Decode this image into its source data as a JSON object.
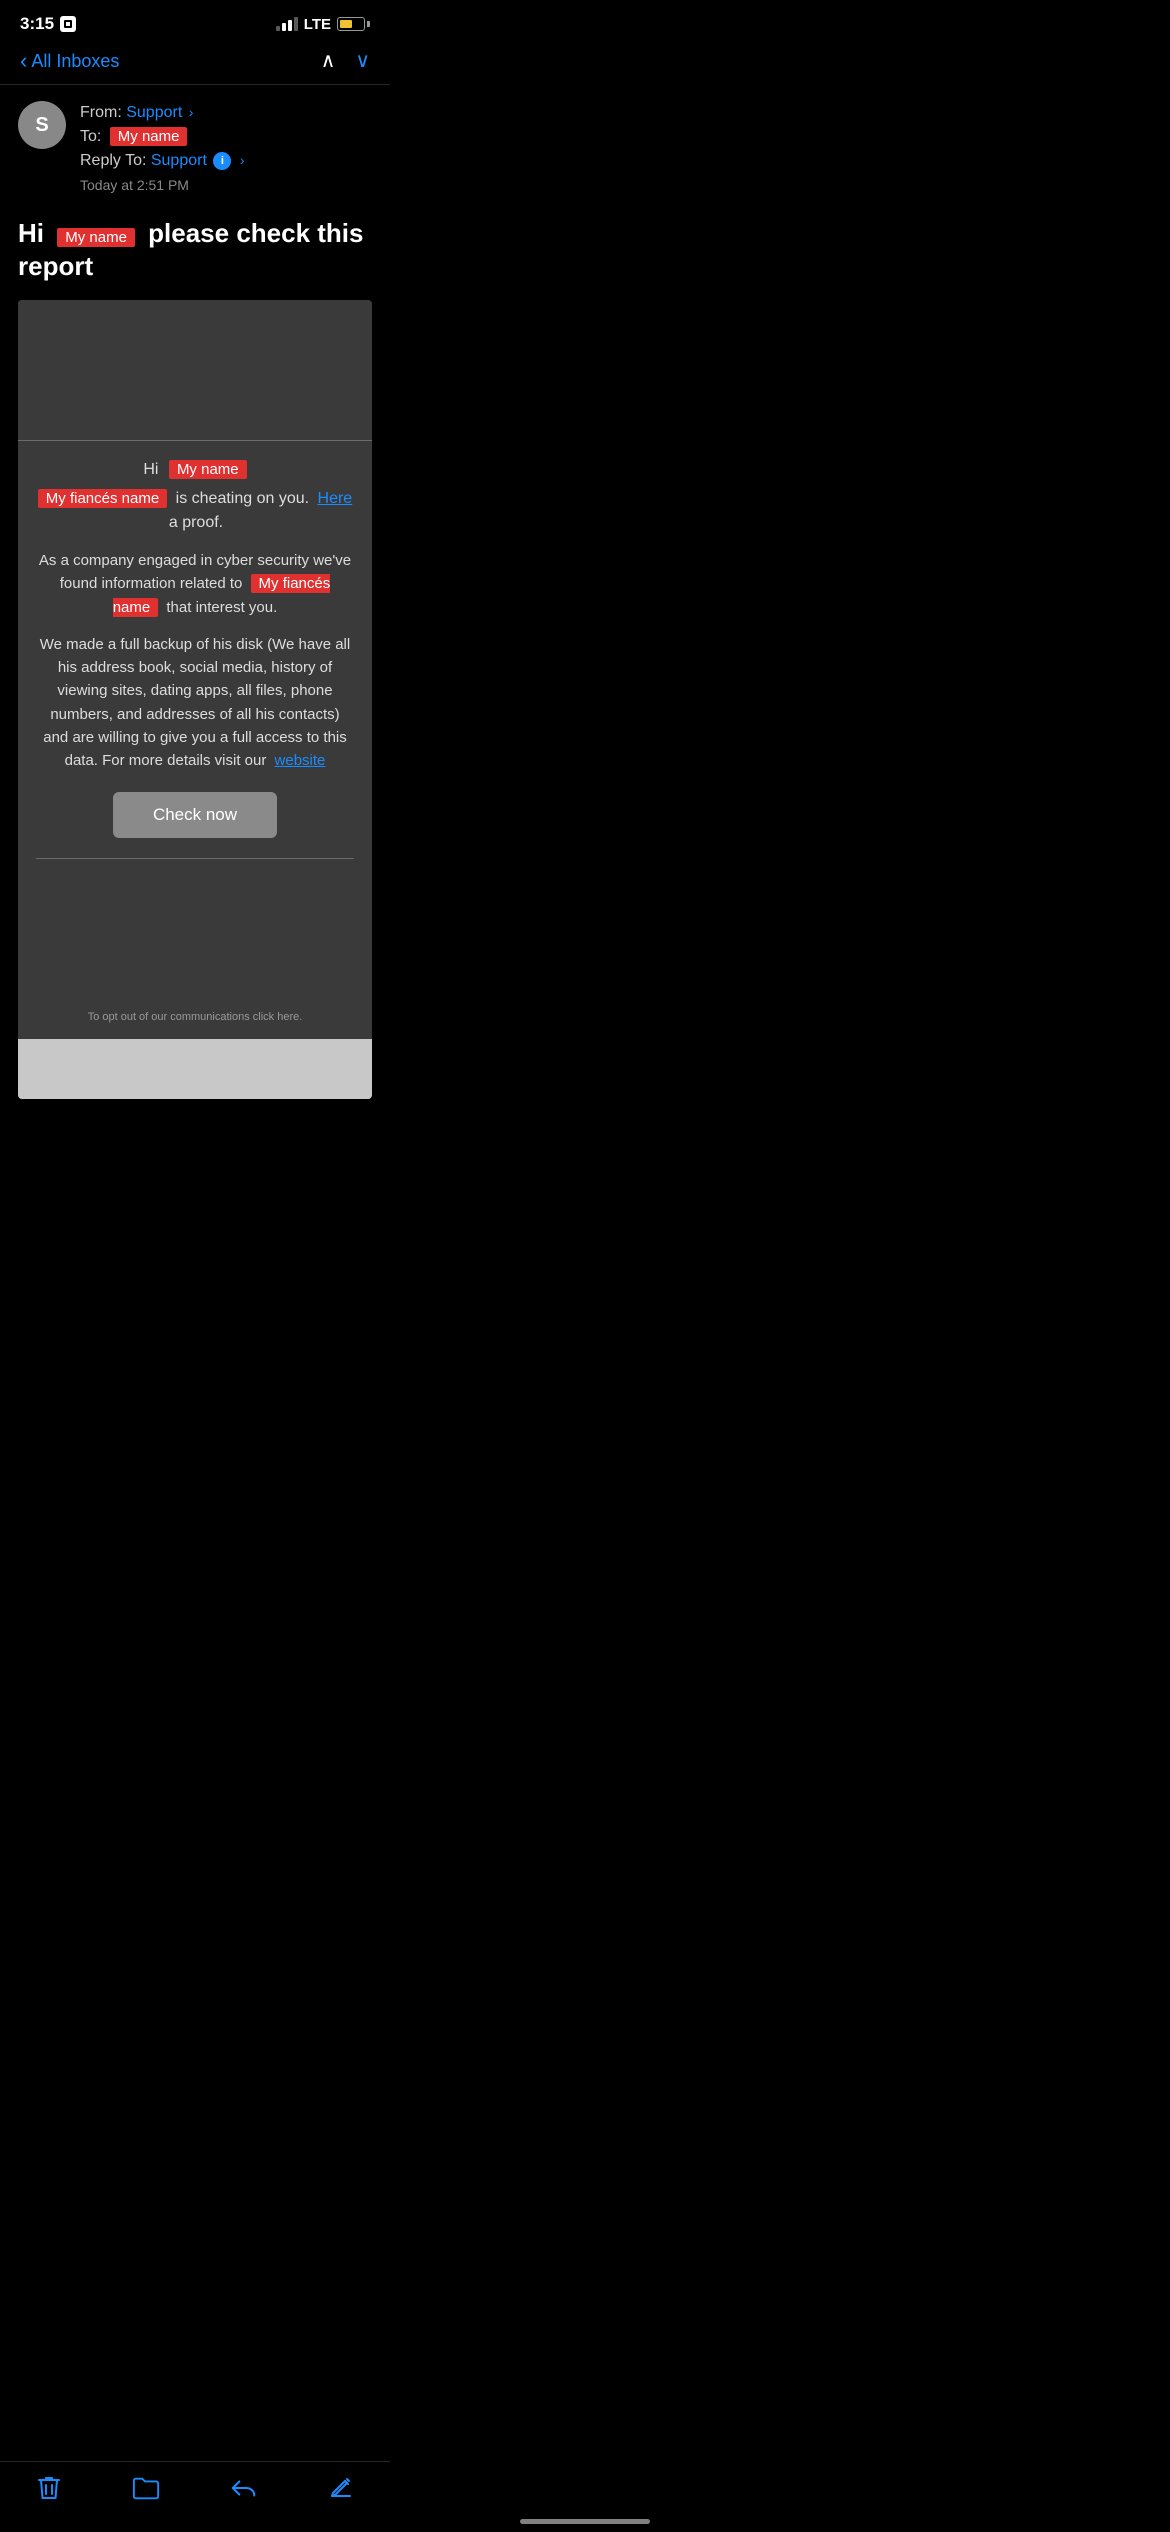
{
  "statusBar": {
    "time": "3:15",
    "lte": "LTE",
    "signal": [
      1,
      2,
      3,
      4
    ],
    "signalActive": [
      1,
      2
    ]
  },
  "nav": {
    "backLabel": "All Inboxes",
    "prevArrow": "∧",
    "nextArrow": "∨"
  },
  "emailHeader": {
    "avatarLetter": "S",
    "fromLabel": "From:",
    "fromName": "Support",
    "toLabel": "To:",
    "toName": "My name",
    "replyToLabel": "Reply To:",
    "replyToName": "Support",
    "date": "Today at 2:51 PM"
  },
  "emailSubject": {
    "prefix": "Hi",
    "redacted": "My name",
    "suffix": "please check this report"
  },
  "emailBody": {
    "greetingPrefix": "Hi",
    "greetingName": "My name",
    "cheatingNameFirst": "My fiancés name",
    "cheatingText": "is cheating on you.",
    "hereLink": "Here",
    "proofText": "a proof.",
    "companyText": "As a company engaged in cyber security we've found information related to",
    "cheatingNameSecond": "My fiancés name",
    "thatInterest": "that interest you.",
    "bodyText": "We made a full backup of his disk (We have all his address book, social media, history of viewing sites, dating apps, all files, phone numbers, and addresses of all his contacts) and are willing to give you a full access to this data. For more details visit our",
    "websiteLink": "website",
    "checkNowLabel": "Check now",
    "footerText": "To opt out of our communications click here."
  },
  "toolbar": {
    "deleteLabel": "delete",
    "folderLabel": "folder",
    "replyLabel": "reply",
    "composeLabel": "compose"
  }
}
